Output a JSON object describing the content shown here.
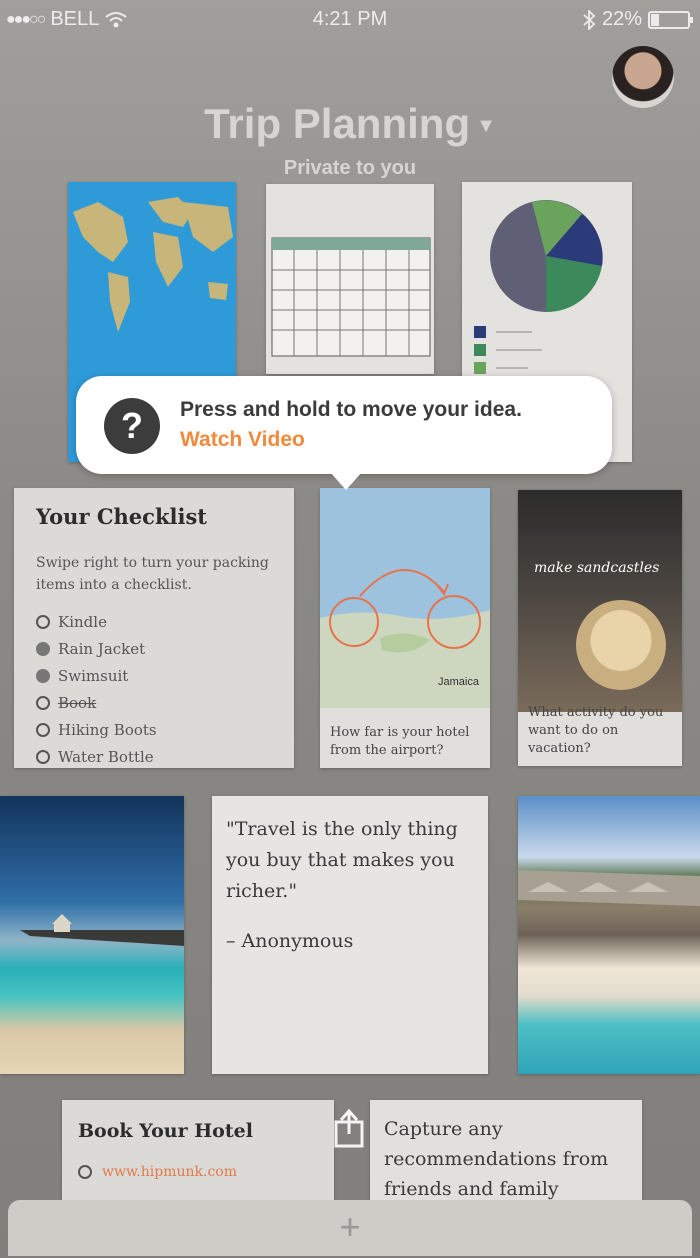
{
  "status": {
    "carrier": "BELL",
    "time": "4:21 PM",
    "battery": "22%",
    "battery_level": 0.22,
    "signal_dots": "●●●○○"
  },
  "header": {
    "title": "Trip Planning",
    "subtitle": "Private to you"
  },
  "tooltip": {
    "text": "Press and hold to move your idea.",
    "link": "Watch Video"
  },
  "checklist": {
    "title": "Your Checklist",
    "description": "Swipe right to turn your packing items into a checklist.",
    "items": [
      {
        "label": "Kindle",
        "state": "open"
      },
      {
        "label": "Rain Jacket",
        "state": "done"
      },
      {
        "label": "Swimsuit",
        "state": "done"
      },
      {
        "label": "Book",
        "state": "struck"
      },
      {
        "label": "Hiking Boots",
        "state": "open"
      },
      {
        "label": "Water Bottle",
        "state": "open"
      }
    ]
  },
  "cards": {
    "map_caption": "How far is your hotel from the airport?",
    "map_label": "Jamaica",
    "sandcastle_title": "make sandcastles",
    "sandcastle_caption": "What activity do you want to do on vacation?",
    "quote": "\"Travel is the only thing you buy that makes you richer.\"",
    "quote_author": "– Anonymous",
    "hotel_title": "Book Your Hotel",
    "hotel_link": "www.hipmunk.com",
    "capture_text": "Capture any recommendations from friends and family"
  },
  "add_button": "+",
  "colors": {
    "accent": "#f28a3e",
    "pie": [
      "#5f5f76",
      "#6aa35c",
      "#2b3b7a",
      "#3c8a5b"
    ]
  }
}
